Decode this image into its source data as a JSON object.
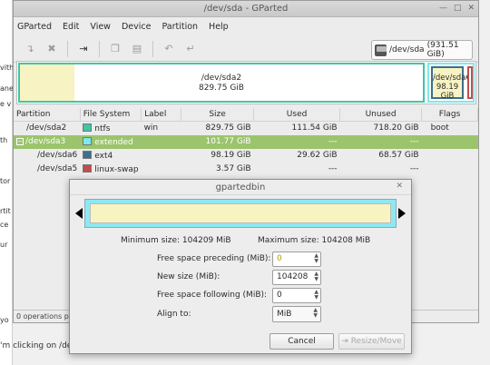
{
  "window": {
    "title": "/dev/sda - GParted"
  },
  "menu": [
    "GParted",
    "Edit",
    "View",
    "Device",
    "Partition",
    "Help"
  ],
  "device": {
    "label": "/dev/sda",
    "size": "(931.51 GiB)"
  },
  "graph": {
    "ntfs": {
      "name": "/dev/sda2",
      "size": "829.75 GiB"
    },
    "ext4": {
      "name": "/dev/sda6",
      "size": "98.19 GiB"
    }
  },
  "table": {
    "headers": [
      "Partition",
      "File System",
      "Label",
      "Size",
      "Used",
      "Unused",
      "Flags"
    ],
    "rows": [
      {
        "partition": "/dev/sda2",
        "fs": "ntfs",
        "label": "win",
        "size": "829.75 GiB",
        "used": "111.54 GiB",
        "unused": "718.20 GiB",
        "flags": "boot",
        "color": "#43c4a5"
      },
      {
        "partition": "/dev/sda3",
        "fs": "extended",
        "label": "",
        "size": "101.77 GiB",
        "used": "---",
        "unused": "---",
        "flags": "",
        "color": "#7ee8ec"
      },
      {
        "partition": "/dev/sda6",
        "fs": "ext4",
        "label": "",
        "size": "98.19 GiB",
        "used": "29.62 GiB",
        "unused": "68.57 GiB",
        "flags": "",
        "color": "#3f6e8f"
      },
      {
        "partition": "/dev/sda5",
        "fs": "linux-swap",
        "label": "",
        "size": "3.57 GiB",
        "used": "---",
        "unused": "---",
        "flags": "",
        "color": "#c24d4d"
      }
    ]
  },
  "status": "0 operations pe",
  "background_text": {
    "left": [
      "vith",
      "ane",
      "e v",
      "th",
      "tor",
      "rtit",
      "ce",
      "ur",
      "yo"
    ],
    "below": "'m clicking on /dev"
  },
  "dialog": {
    "title": "gpartedbin",
    "min_size": "Minimum size: 104209 MiB",
    "max_size": "Maximum size: 104208 MiB",
    "fields": {
      "preceding_label": "Free space preceding (MiB):",
      "preceding_value": "0",
      "new_size_label": "New size (MiB):",
      "new_size_value": "104208",
      "following_label": "Free space following (MiB):",
      "following_value": "0",
      "align_label": "Align to:",
      "align_value": "MiB"
    },
    "cancel": "Cancel",
    "resize": "Resize/Move"
  }
}
